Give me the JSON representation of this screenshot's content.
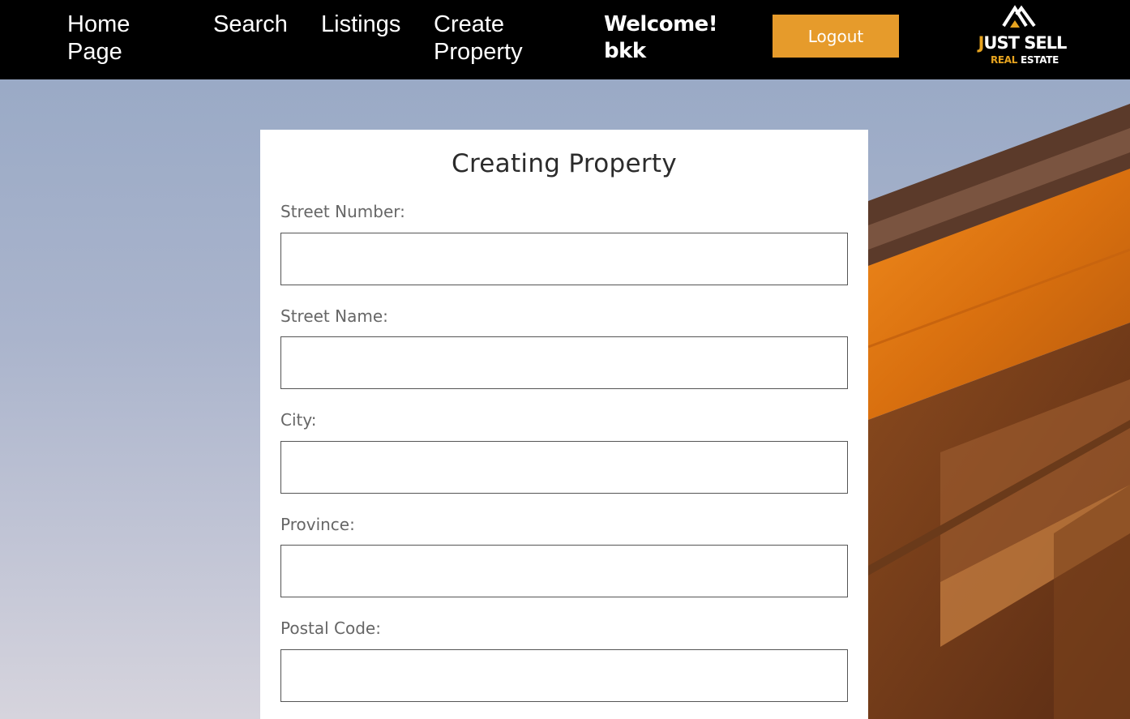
{
  "nav": {
    "home_line1": "Home",
    "home_line2": "Page",
    "search": "Search",
    "listings": "Listings",
    "create_line1": "Create",
    "create_line2": "Property",
    "welcome_line1": "Welcome!",
    "welcome_line2": "bkk",
    "logout": "Logout",
    "logo_j": "J",
    "logo_rest": "UST SELL",
    "logo_real": "REAL",
    "logo_estate": " ESTATE"
  },
  "form": {
    "title": "Creating Property",
    "fields": [
      {
        "label": "Street Number:",
        "value": ""
      },
      {
        "label": "Street Name:",
        "value": ""
      },
      {
        "label": "City:",
        "value": ""
      },
      {
        "label": "Province:",
        "value": ""
      },
      {
        "label": "Postal Code:",
        "value": ""
      }
    ]
  },
  "colors": {
    "navbar_bg": "#000000",
    "accent": "#e69b2b",
    "card_bg": "#ffffff"
  }
}
